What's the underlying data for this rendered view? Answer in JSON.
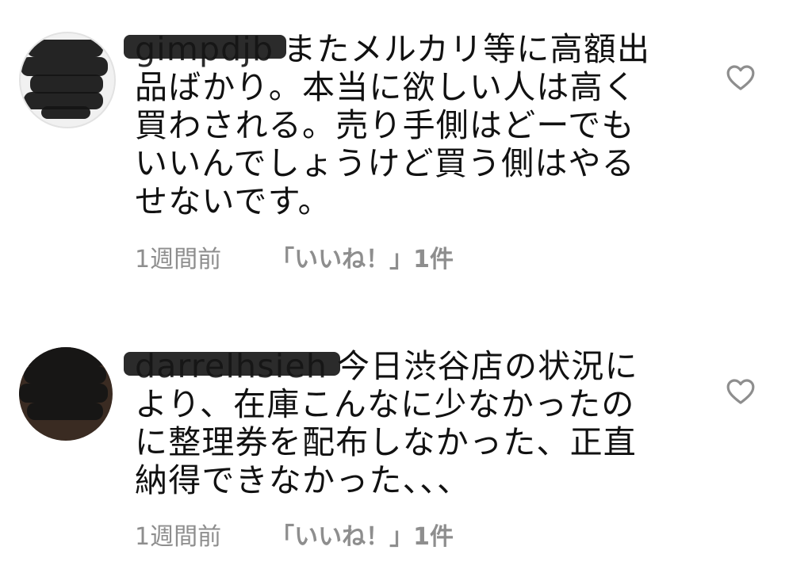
{
  "comments": [
    {
      "username": "gimpdjb",
      "text": "またメルカリ等に高額出品ばかり。本当に欲しい人は高く買わされる。売り手側はどーでもいいんでしょうけど買う側はやるせないです。",
      "time": "1週間前",
      "likes": "「いいね！」1件",
      "like_icon": "heart-outline-icon"
    },
    {
      "username": "darrelhsieh",
      "text": "今日渋谷店の状況により、在庫こんなに少なかったのに整理券を配布しなかった、正直納得できなかった、、、",
      "time": "1週間前",
      "likes": "「いいね！」1件",
      "like_icon": "heart-outline-icon"
    }
  ],
  "colors": {
    "text": "#111111",
    "meta": "#8e8e8e",
    "heart": "#8e8e8e",
    "redaction": "#141414"
  }
}
